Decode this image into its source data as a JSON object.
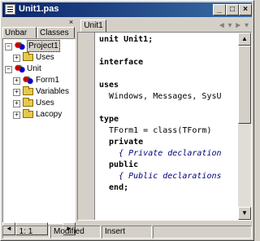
{
  "window": {
    "title": "Unit1.pas"
  },
  "left_panel": {
    "tabs": [
      "Unbar",
      "Classes"
    ],
    "tree": [
      {
        "label": "Project1",
        "level": 0,
        "expanded": true,
        "icon": "project-icon"
      },
      {
        "label": "Uses",
        "level": 1,
        "expanded": false,
        "icon": "folder-icon"
      },
      {
        "label": "Unit",
        "level": 0,
        "expanded": true,
        "icon": "project-icon"
      },
      {
        "label": "Form1",
        "level": 1,
        "expanded": false,
        "icon": "form-icon"
      },
      {
        "label": "Variables",
        "level": 1,
        "expanded": false,
        "icon": "folder-icon"
      },
      {
        "label": "Uses",
        "level": 1,
        "expanded": false,
        "icon": "folder-icon"
      },
      {
        "label": "Lacopy",
        "level": 1,
        "expanded": false,
        "icon": "folder-icon"
      }
    ]
  },
  "editor": {
    "tab": "Unit1",
    "lines": [
      {
        "text": "unit Unit1;",
        "style": "kw"
      },
      {
        "text": "",
        "style": ""
      },
      {
        "text": "interface",
        "style": "kw"
      },
      {
        "text": "",
        "style": ""
      },
      {
        "text": "uses",
        "style": "kw"
      },
      {
        "text": "  Windows, Messages, SysU",
        "style": ""
      },
      {
        "text": "",
        "style": ""
      },
      {
        "text": "type",
        "style": "kw"
      },
      {
        "text": "  TForm1 = class(TForm)",
        "style": ""
      },
      {
        "text": "  private",
        "style": "kw"
      },
      {
        "text": "    { Private declaration",
        "style": "cm"
      },
      {
        "text": "  public",
        "style": "kw"
      },
      {
        "text": "    { Public declarations",
        "style": "cm"
      },
      {
        "text": "  end;",
        "style": "kw"
      }
    ]
  },
  "status": {
    "position": "1:  1",
    "modified": "Modified",
    "mode": "Insert"
  }
}
